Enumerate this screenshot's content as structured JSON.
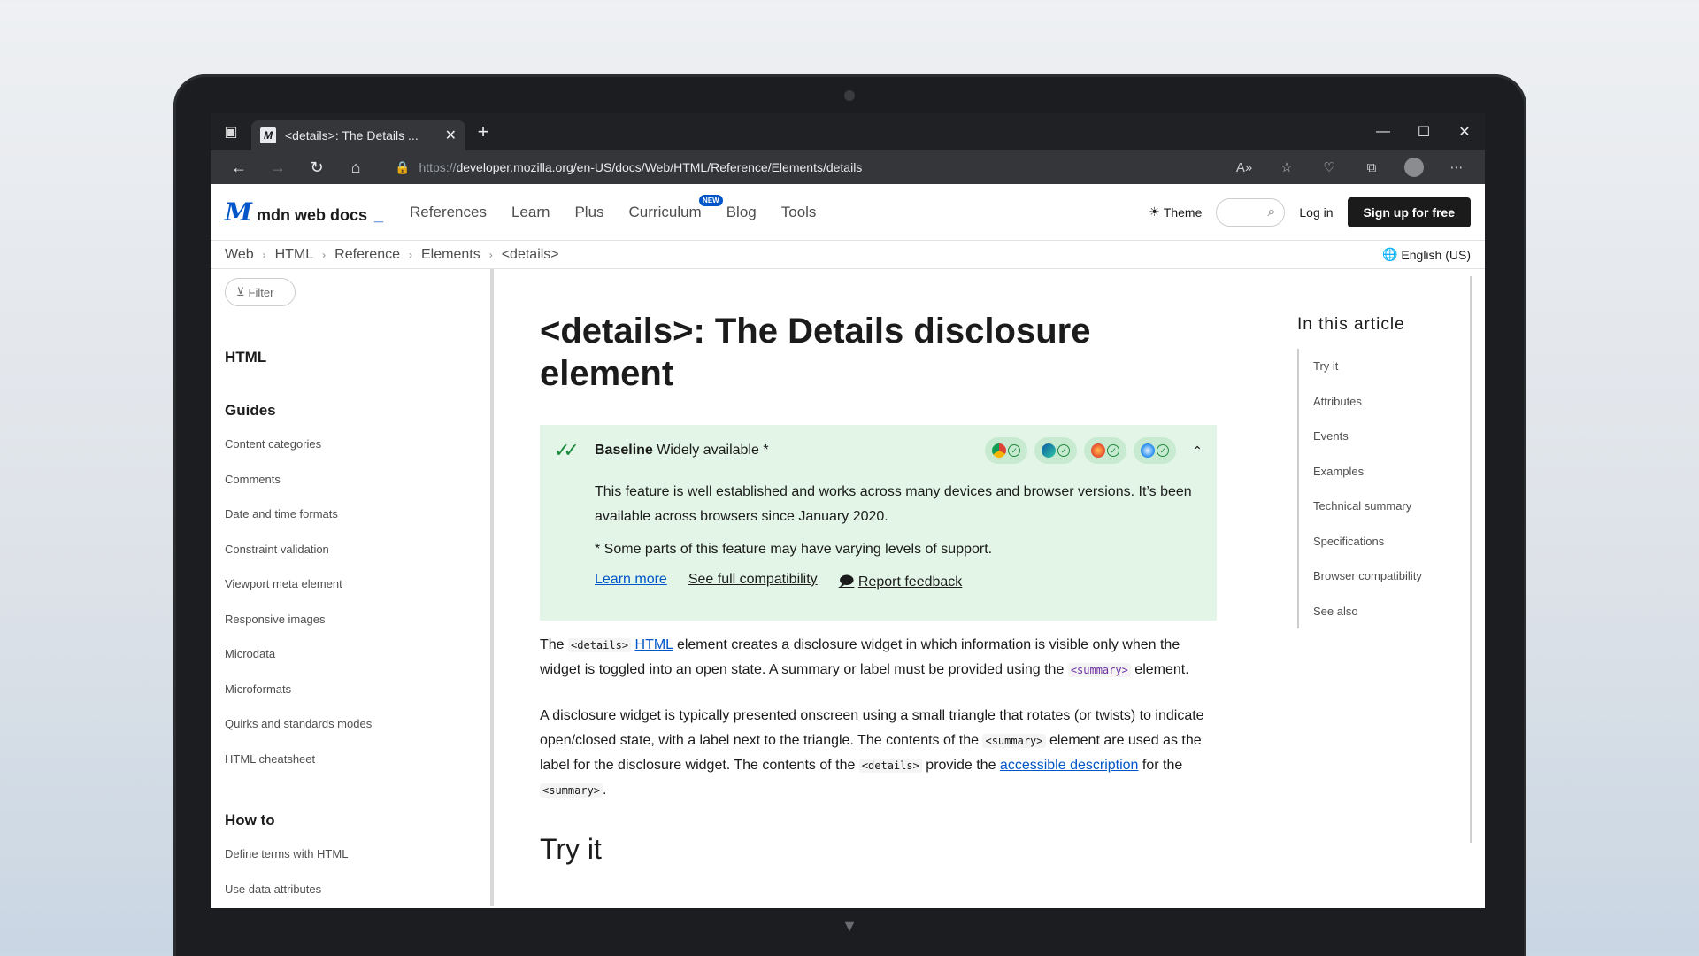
{
  "browser": {
    "tab_title": "<details>: The Details ...",
    "url_proto": "https://",
    "url_rest": "developer.mozilla.org/en-US/docs/Web/HTML/Reference/Elements/details"
  },
  "header": {
    "logo_text": "mdn web docs",
    "nav": [
      "References",
      "Learn",
      "Plus",
      "Curriculum",
      "Blog",
      "Tools"
    ],
    "new_badge": "NEW",
    "theme": "Theme",
    "login": "Log in",
    "signup": "Sign up for free"
  },
  "breadcrumb": [
    "Web",
    "HTML",
    "Reference",
    "Elements",
    "<details>"
  ],
  "language": "English (US)",
  "sidebar": {
    "filter": "Filter",
    "section_html": "HTML",
    "guides_heading": "Guides",
    "guides": [
      "Content categories",
      "Comments",
      "Date and time formats",
      "Constraint validation",
      "Viewport meta element",
      "Responsive images",
      "Microdata",
      "Microformats",
      "Quirks and standards modes",
      "HTML cheatsheet"
    ],
    "howto_heading": "How to",
    "howto": [
      "Define terms with HTML",
      "Use data attributes"
    ]
  },
  "article": {
    "title": "<details>: The Details disclosure element",
    "baseline_label": "Baseline",
    "baseline_status": "Widely available *",
    "baseline_desc": "This feature is well established and works across many devices and browser versions. It’s been available across browsers since January 2020.",
    "baseline_note": "* Some parts of this feature may have varying levels of support.",
    "links": [
      "Learn more",
      "See full compatibility",
      "Report feedback"
    ],
    "p1_a": "The",
    "p1_code": "<details>",
    "p1_link": "HTML",
    "p1_b": "element creates a disclosure widget in which information is visible only when the widget is toggled into an open state. A summary or label must be provided using the",
    "p1_code2": "<summary>",
    "p1_c": "element.",
    "p2_a": "A disclosure widget is typically presented onscreen using a small triangle that rotates (or twists) to indicate open/closed state, with a label next to the triangle. The contents of the",
    "p2_code": "<summary>",
    "p2_b": "element are used as the label for the disclosure widget. The contents of the",
    "p2_code2": "<details>",
    "p2_c": "provide the",
    "p2_link": "accessible description",
    "p2_d": "for the",
    "p2_code3": "<summary>",
    "p2_e": ".",
    "h2": "Try it"
  },
  "toc": {
    "heading": "In this article",
    "items": [
      "Try it",
      "Attributes",
      "Events",
      "Examples",
      "Technical summary",
      "Specifications",
      "Browser compatibility",
      "See also"
    ]
  },
  "colors": {
    "accent": "#0056c8",
    "baseline_bg": "#e2f5e6",
    "baseline_check": "#1e8a3f"
  }
}
